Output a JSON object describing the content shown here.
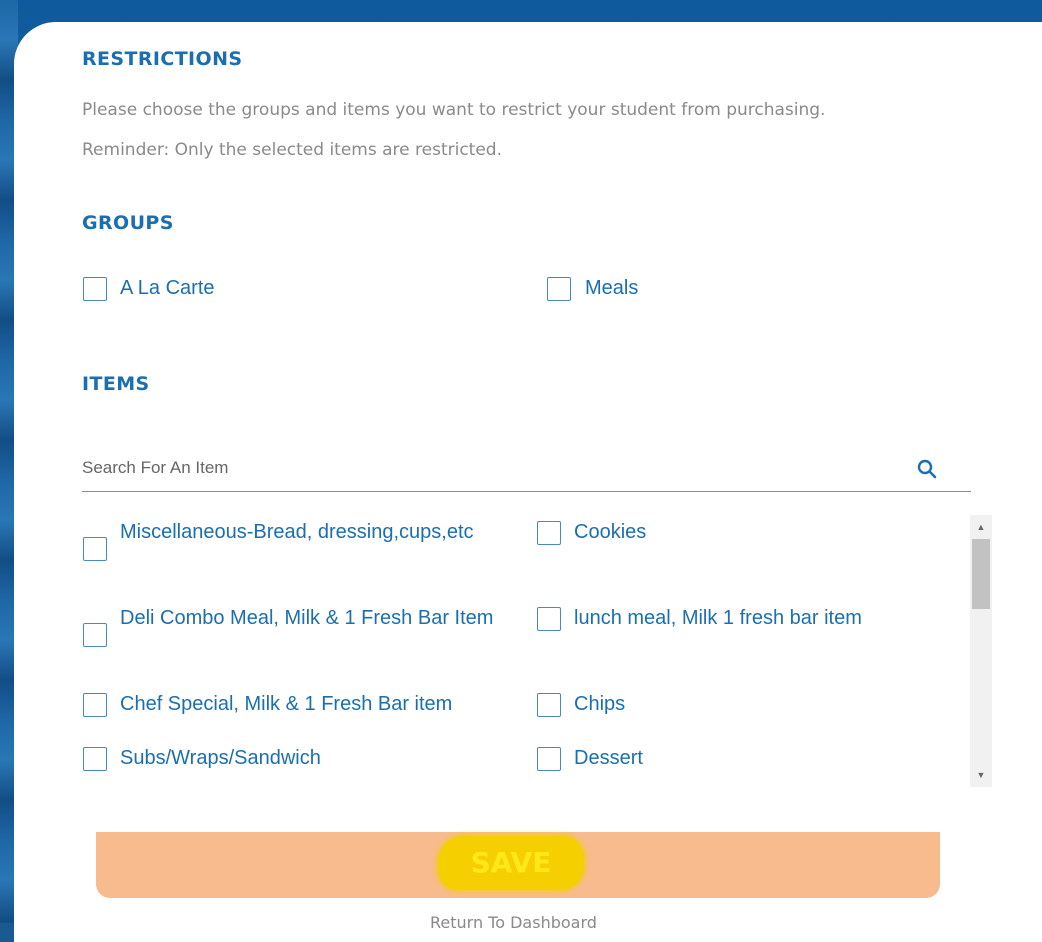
{
  "restrictions": {
    "title": "RESTRICTIONS",
    "description": "Please choose the groups and items you want to restrict your student from purchasing.",
    "reminder": "Reminder: Only the selected items are restricted."
  },
  "groups": {
    "title": "GROUPS",
    "options": [
      {
        "label": "A La Carte",
        "checked": false
      },
      {
        "label": "Meals",
        "checked": false
      }
    ]
  },
  "items": {
    "title": "ITEMS",
    "search_placeholder": "Search For An Item",
    "list": [
      {
        "label": "Miscellaneous-Bread, dressing,cups,etc",
        "checked": false
      },
      {
        "label": "Cookies",
        "checked": false
      },
      {
        "label": "Deli Combo Meal, Milk & 1 Fresh Bar Item",
        "checked": false
      },
      {
        "label": "lunch meal, Milk 1 fresh bar item",
        "checked": false
      },
      {
        "label": "Chef Special, Milk & 1 Fresh Bar item",
        "checked": false
      },
      {
        "label": "Chips",
        "checked": false
      },
      {
        "label": "Subs/Wraps/Sandwich",
        "checked": false
      },
      {
        "label": "Dessert",
        "checked": false
      }
    ]
  },
  "save_label": "SAVE",
  "return_link": "Return To Dashboard",
  "colors": {
    "accent": "#1b6fb0",
    "save_button": "#f8bb8d",
    "save_highlight": "#f5cf00"
  }
}
